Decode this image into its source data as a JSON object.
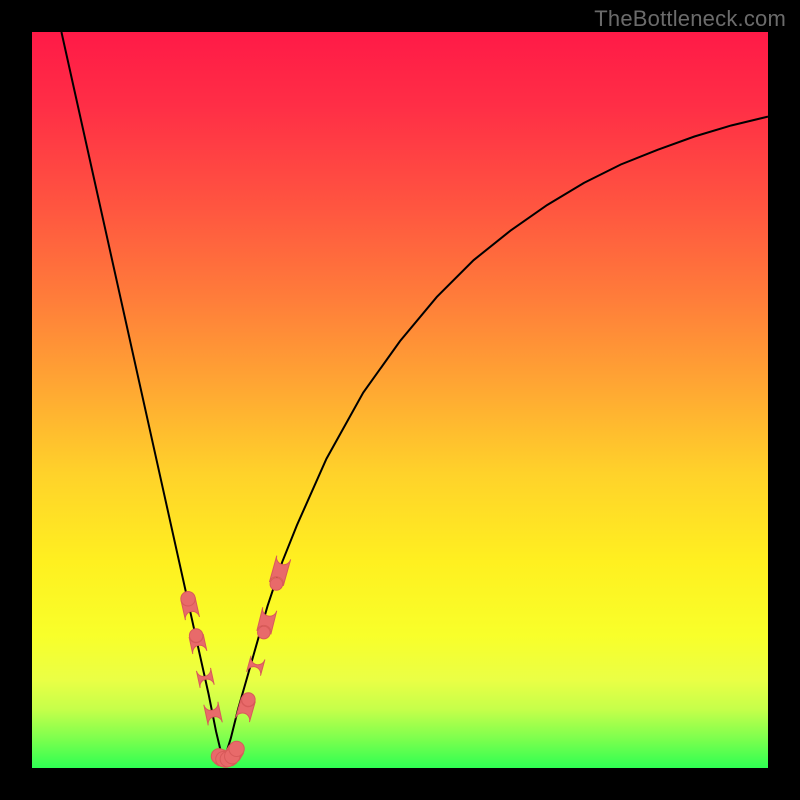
{
  "watermark": "TheBottleneck.com",
  "colors": {
    "frame": "#000000",
    "curve": "#000000",
    "marker_fill": "#e86a6a",
    "marker_stroke": "#d85a5a",
    "gradient_top": "#ff1a47",
    "gradient_mid": "#ffd22a",
    "gradient_bottom": "#2eff52"
  },
  "chart_data": {
    "type": "line",
    "title": "",
    "xlabel": "",
    "ylabel": "",
    "xlim": [
      0,
      100
    ],
    "ylim": [
      0,
      100
    ],
    "grid": false,
    "legend": false,
    "min_x": 26,
    "series": [
      {
        "name": "left-branch",
        "x": [
          4,
          6,
          8,
          10,
          12,
          14,
          16,
          18,
          20,
          22,
          23,
          24,
          25,
          26
        ],
        "y": [
          100,
          91,
          82,
          73,
          64,
          55,
          46,
          37,
          28,
          19,
          14.5,
          10,
          5,
          0.8
        ]
      },
      {
        "name": "right-branch",
        "x": [
          26,
          27,
          28,
          30,
          32,
          34,
          36,
          40,
          45,
          50,
          55,
          60,
          65,
          70,
          75,
          80,
          85,
          90,
          95,
          100
        ],
        "y": [
          0.8,
          4,
          8,
          15,
          22,
          28,
          33,
          42,
          51,
          58,
          64,
          69,
          73,
          76.5,
          79.5,
          82,
          84,
          85.8,
          87.3,
          88.5
        ]
      }
    ],
    "markers": {
      "left_cluster": [
        [
          21.2,
          23
        ],
        [
          21.8,
          20.3
        ],
        [
          22.3,
          18
        ],
        [
          22.8,
          15.7
        ],
        [
          23.3,
          13.4
        ],
        [
          23.8,
          11.1
        ],
        [
          24.3,
          8.8
        ],
        [
          24.9,
          6
        ]
      ],
      "bottom_cluster": [
        [
          25.4,
          1.6
        ],
        [
          26.0,
          1.2
        ],
        [
          26.6,
          1.2
        ],
        [
          27.2,
          1.6
        ],
        [
          27.8,
          2.6
        ]
      ],
      "right_cluster": [
        [
          28.6,
          6.5
        ],
        [
          29.4,
          9.3
        ],
        [
          30.1,
          12.8
        ],
        [
          30.7,
          15
        ],
        [
          31.5,
          18.4
        ],
        [
          32.3,
          21.6
        ],
        [
          33.2,
          25
        ],
        [
          34.2,
          28.6
        ]
      ],
      "marker_radius": 9
    }
  }
}
